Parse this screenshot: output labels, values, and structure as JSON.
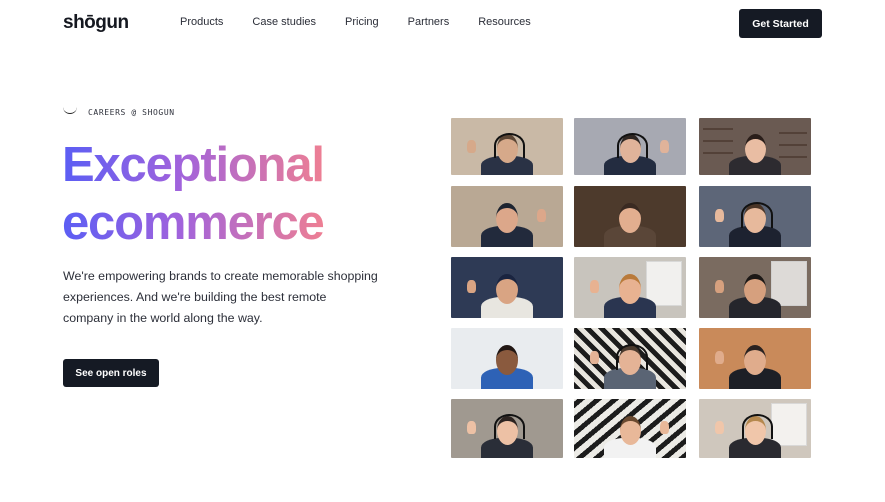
{
  "brand": {
    "logo_text": "shōgun"
  },
  "nav": {
    "items": [
      "Products",
      "Case studies",
      "Pricing",
      "Partners",
      "Resources"
    ]
  },
  "header": {
    "cta_label": "Get Started"
  },
  "hero": {
    "eyebrow": "CAREERS @ SHOGUN",
    "headline_line1": "Exceptional",
    "headline_line2": "ecommerce",
    "body_line1": "We're empowering brands to create memorable shopping",
    "body_line2": "experiences. And we're building the best remote",
    "body_line3": "company in the world along the way.",
    "cta_label": "See open roles"
  },
  "colors": {
    "gradient_start": "#5b5ef4",
    "gradient_mid": "#a163dc",
    "gradient_end": "#ee7f93",
    "button_bg": "#151a24"
  },
  "video_grid": {
    "rows": 5,
    "columns": 3,
    "tiles": [
      {
        "bg": "#c9b9a6",
        "pattern": "plain",
        "head": "#d6a98a",
        "hair": "#5a4534",
        "shirt": "#2a3245",
        "headset": true,
        "wave": "left"
      },
      {
        "bg": "#a7a9b2",
        "pattern": "plain",
        "head": "#e0b39a",
        "hair": "#2e2622",
        "shirt": "#232c40",
        "headset": true,
        "wave": "right"
      },
      {
        "bg": "#6a5a52",
        "pattern": "shelves",
        "head": "#e9bda3",
        "hair": "#2a1e1a",
        "shirt": "#2d2b30",
        "headset": false,
        "wave": "none"
      },
      {
        "bg": "#b9a894",
        "pattern": "plain",
        "head": "#dca78a",
        "hair": "#1d2430",
        "shirt": "#222a3c",
        "headset": false,
        "wave": "right"
      },
      {
        "bg": "#4d3a2c",
        "pattern": "plain",
        "head": "#e2ae8f",
        "hair": "#3a2a22",
        "shirt": "#5a4638",
        "headset": false,
        "wave": "none"
      },
      {
        "bg": "#5d6678",
        "pattern": "plain",
        "head": "#e7b99c",
        "hair": "#4a3527",
        "shirt": "#1d2230",
        "headset": true,
        "wave": "left"
      },
      {
        "bg": "#2e3a55",
        "pattern": "plain",
        "head": "#d9a483",
        "hair": "#1a2440",
        "shirt": "#e8e6e0",
        "headset": false,
        "wave": "left"
      },
      {
        "bg": "#c8c4bd",
        "pattern": "window",
        "head": "#e8b291",
        "hair": "#b97a3a",
        "shirt": "#2a3550",
        "headset": false,
        "wave": "left"
      },
      {
        "bg": "#7a6b60",
        "pattern": "window",
        "head": "#d6a07e",
        "hair": "#1c1816",
        "shirt": "#25262c",
        "headset": false,
        "wave": "left"
      },
      {
        "bg": "#e9ecef",
        "pattern": "plain",
        "head": "#8a5a3e",
        "hair": "#221714",
        "shirt": "#2e62b6",
        "headset": false,
        "wave": "none"
      },
      {
        "bg": "#e2dfd8",
        "pattern": "stripes",
        "head": "#e4b396",
        "hair": "#4a3a2e",
        "shirt": "#5a6474",
        "headset": true,
        "wave": "left"
      },
      {
        "bg": "#c98a5a",
        "pattern": "plain",
        "head": "#e0ac8c",
        "hair": "#2a2220",
        "shirt": "#1d1f26",
        "headset": false,
        "wave": "left"
      },
      {
        "bg": "#a09990",
        "pattern": "plain",
        "head": "#edc1a5",
        "hair": "#2c2320",
        "shirt": "#2a2e38",
        "headset": true,
        "wave": "left"
      },
      {
        "bg": "#e7e5df",
        "pattern": "stripes2",
        "head": "#e8b899",
        "hair": "#6a4a30",
        "shirt": "#f2f2f2",
        "headset": false,
        "wave": "right"
      },
      {
        "bg": "#cfc7bd",
        "pattern": "window",
        "head": "#f0c6aa",
        "hair": "#b5884e",
        "shirt": "#2a2a30",
        "headset": true,
        "wave": "left"
      }
    ]
  }
}
